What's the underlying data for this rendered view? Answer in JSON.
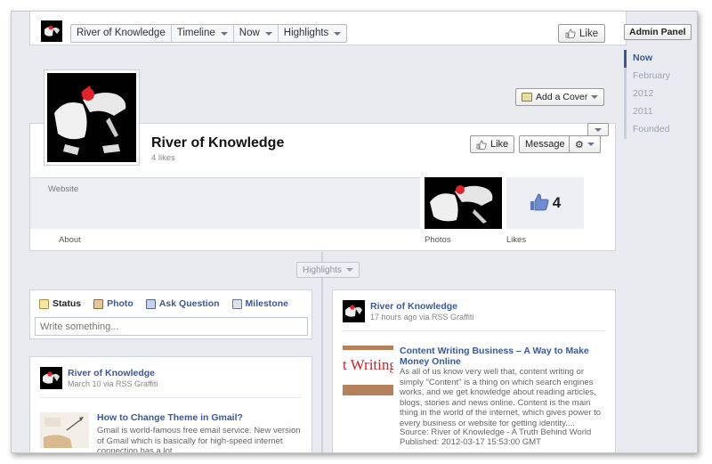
{
  "topbar": {
    "nav": [
      "River of Knowledge",
      "Timeline",
      "Now",
      "Highlights"
    ],
    "like_label": "Like"
  },
  "admin_panel_label": "Admin Panel",
  "years": [
    "Now",
    "February",
    "2012",
    "2011",
    "Founded"
  ],
  "cover": {
    "add_cover_label": "Add a Cover",
    "page_name": "River of Knowledge",
    "likes_text": "4 likes",
    "like_label": "Like",
    "message_label": "Message",
    "website_label": "Website",
    "likes_count": "4",
    "about_label": "About",
    "photos_label": "Photos",
    "likes_label": "Likes"
  },
  "highlights_label": "Highlights",
  "composer": {
    "tabs": [
      "Status",
      "Photo",
      "Ask Question",
      "Milestone"
    ],
    "placeholder": "Write something..."
  },
  "post_left": {
    "author": "River of Knowledge",
    "meta": "March 10 via RSS Graffiti",
    "title": "How to Change Theme in Gmail?",
    "body": "Gmail is world-famous free email service. New version of Gmail which is basically for high-speed internet connection has a lot"
  },
  "post_right": {
    "author": "River of Knowledge",
    "meta": "17 hours ago via RSS Graffiti",
    "thumb_text": "t Writing",
    "title": "Content Writing Business – A Way to Make Money Online",
    "body": "As all of us know very well that, content writing or simply \"Content\" is a thing on which search engines works, and we get knowledge about reading articles, blogs, stories and news online. Content is the main thing in the world of the internet, which gives power to every business or website for getting identity....",
    "source": "Source: River of Knowledge - A Truth Behind World",
    "published": "Published: 2012-03-17 15:53:00 GMT"
  },
  "colors": {
    "brand": "#3b5998",
    "background": "#e9ebf0",
    "accent_red": "#e0252a"
  }
}
